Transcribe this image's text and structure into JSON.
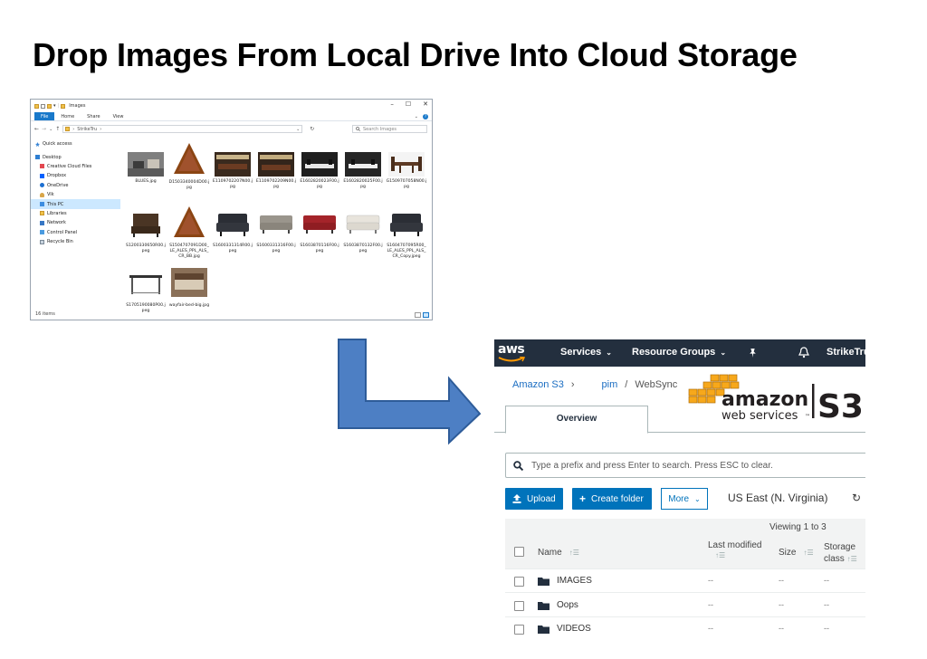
{
  "slide": {
    "title": "Drop Images From Local Drive Into Cloud Storage"
  },
  "explorer": {
    "window_title": "Images",
    "controls": {
      "minimize": "–",
      "maximize": "☐",
      "close": "✕"
    },
    "ribbon_tabs": [
      "File",
      "Home",
      "Share",
      "View"
    ],
    "help": "?",
    "address": {
      "back": "←",
      "forward": "→",
      "history": "⌄",
      "up": "↑",
      "path": "StrikeTru",
      "chevron": "›",
      "dropdown": "⌄",
      "refresh": "↻"
    },
    "search_placeholder": "Search Images",
    "nav": [
      {
        "label": "Quick access",
        "icon": "star-icon"
      },
      {
        "label": "Desktop",
        "icon": "desktop-icon"
      },
      {
        "label": "Creative Cloud Files",
        "icon": "folder-icon"
      },
      {
        "label": "Dropbox",
        "icon": "dropbox-icon"
      },
      {
        "label": "OneDrive",
        "icon": "cloud-icon"
      },
      {
        "label": "Vik",
        "icon": "user-icon"
      },
      {
        "label": "This PC",
        "icon": "pc-icon"
      },
      {
        "label": "Libraries",
        "icon": "library-icon"
      },
      {
        "label": "Network",
        "icon": "network-icon"
      },
      {
        "label": "Control Panel",
        "icon": "control-panel-icon"
      },
      {
        "label": "Recycle Bin",
        "icon": "recycle-bin-icon"
      }
    ],
    "files": [
      {
        "name": "BLUES.jpg"
      },
      {
        "name": "D1503340004D00.jpg"
      },
      {
        "name": "E1109702207N00.jpg"
      },
      {
        "name": "E1109702209N00.jpg"
      },
      {
        "name": "E1602820023F00.jpg"
      },
      {
        "name": "E1602820025F00.jpg"
      },
      {
        "name": "G1509707058N00.jpg"
      },
      {
        "name": "S1200330650R00.jpeg"
      },
      {
        "name": "S1504707091D00_LE_ALES_PPL_ALS_CR_BB.jpg"
      },
      {
        "name": "S1600331314R00.jpeg"
      },
      {
        "name": "S1600331316F00.jpeg"
      },
      {
        "name": "S1603870116F00.jpeg"
      },
      {
        "name": "S1603870132F00.jpeg"
      },
      {
        "name": "S1604707095R00_LE_ALES_PPL_ALS_CR_Copy.jpeg"
      },
      {
        "name": "S1705190080P00.jpeg"
      },
      {
        "name": "wayfair-bed-big.jpg"
      }
    ],
    "status": "16 items"
  },
  "aws": {
    "logo": "aws",
    "menu": {
      "services": "Services",
      "resource_groups": "Resource Groups",
      "user": "StrikeTru"
    },
    "breadcrumb": {
      "root": "Amazon S3",
      "sep1": "›",
      "bucket": "pim",
      "sep2": "/",
      "folder": "WebSync"
    },
    "tab": "Overview",
    "search_placeholder": "Type a prefix and press Enter to search. Press ESC to clear.",
    "buttons": {
      "upload": "Upload",
      "create_folder": "Create folder",
      "more": "More"
    },
    "region": "US East (N. Virginia)",
    "viewing": "Viewing 1 to 3",
    "columns": {
      "name": "Name",
      "last_modified": "Last modified",
      "size": "Size",
      "storage_class": "Storage class"
    },
    "rows": [
      {
        "name": "IMAGES",
        "last_modified": "--",
        "size": "--",
        "storage_class": "--"
      },
      {
        "name": "Oops",
        "last_modified": "--",
        "size": "--",
        "storage_class": "--"
      },
      {
        "name": "VIDEOS",
        "last_modified": "--",
        "size": "--",
        "storage_class": "--"
      }
    ],
    "brand_logo": {
      "amazon": "amazon",
      "webservices": "web services",
      "tm": "™",
      "s3": "S3"
    }
  }
}
